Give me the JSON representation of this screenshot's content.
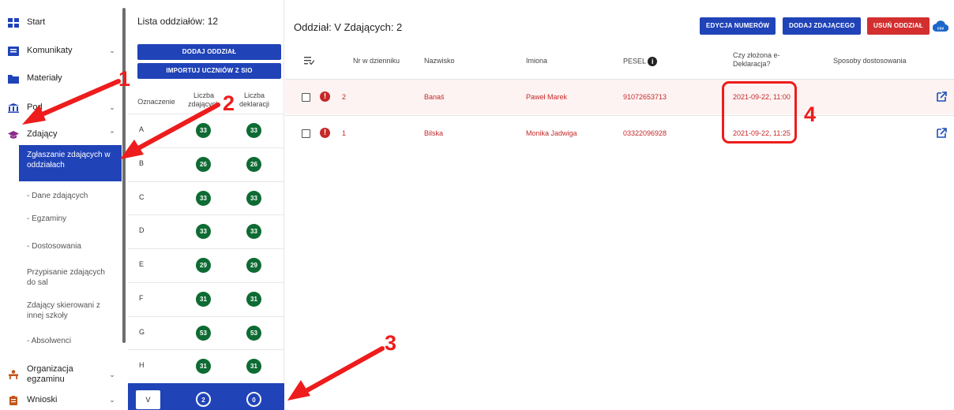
{
  "nav": {
    "items": [
      {
        "label": "Start",
        "icon": "grid-icon"
      },
      {
        "label": "Komunikaty",
        "icon": "message-icon"
      },
      {
        "label": "Materiały",
        "icon": "folder-icon"
      },
      {
        "label": "Podmioty",
        "icon": "institution-icon"
      },
      {
        "label": "Zdający",
        "icon": "graduation-cap-icon"
      },
      {
        "label": "Organizacja egzaminu",
        "icon": "desk-icon"
      },
      {
        "label": "Wnioski",
        "icon": "clipboard-icon"
      }
    ],
    "podmioty_visible": "Pod",
    "subitems": [
      "Zgłaszanie zdających w oddziałach",
      "Dane zdających",
      "Egzaminy",
      "Dostosowania",
      "Przypisanie zdających do sal",
      "Zdający skierowani z innej szkoły",
      "Absolwenci"
    ]
  },
  "classes": {
    "title": "Lista oddziałów: 12",
    "add_button": "DODAJ ODDZIAŁ",
    "import_button": "IMPORTUJ UCZNIÓW Z SIO",
    "headers": {
      "code": "Oznaczenie",
      "students": "Liczba zdających",
      "declarations": "Liczba deklaracji"
    },
    "rows": [
      {
        "code": "A",
        "students": "33",
        "declarations": "33"
      },
      {
        "code": "B",
        "students": "26",
        "declarations": "26"
      },
      {
        "code": "C",
        "students": "33",
        "declarations": "33"
      },
      {
        "code": "D",
        "students": "33",
        "declarations": "33"
      },
      {
        "code": "E",
        "students": "29",
        "declarations": "29"
      },
      {
        "code": "F",
        "students": "31",
        "declarations": "31"
      },
      {
        "code": "G",
        "students": "53",
        "declarations": "53"
      },
      {
        "code": "H",
        "students": "31",
        "declarations": "31"
      },
      {
        "code": "V",
        "students": "2",
        "declarations": "0"
      }
    ]
  },
  "main": {
    "title": "Oddział: V Zdających: 2",
    "buttons": {
      "edit_numbers": "EDYCJA NUMERÓW",
      "add_student": "DODAJ ZDAJĄCEGO",
      "delete_class": "USUŃ ODDZIAŁ",
      "csv": "csv"
    },
    "columns": {
      "number": "Nr w dzienniku",
      "surname": "Nazwisko",
      "names": "Imiona",
      "pesel": "PESEL",
      "declaration": "Czy złożona e-Deklaracja?",
      "adjustments": "Sposoby dostosowania"
    },
    "rows": [
      {
        "number": "2",
        "surname": "Banaś",
        "names": "Paweł Marek",
        "pesel": "91072653713",
        "declaration": "2021-09-22, 11:00",
        "adjustments": ""
      },
      {
        "number": "1",
        "surname": "Bilska",
        "names": "Monika Jadwiga",
        "pesel": "03322096928",
        "declaration": "2021-09-22, 11:25",
        "adjustments": ""
      }
    ]
  },
  "annotations": [
    "1",
    "2",
    "3",
    "4"
  ],
  "colors": {
    "primary": "#2043b8",
    "danger": "#d32f2f",
    "pill": "#0e6b33",
    "annotation": "#ee1c1c"
  }
}
